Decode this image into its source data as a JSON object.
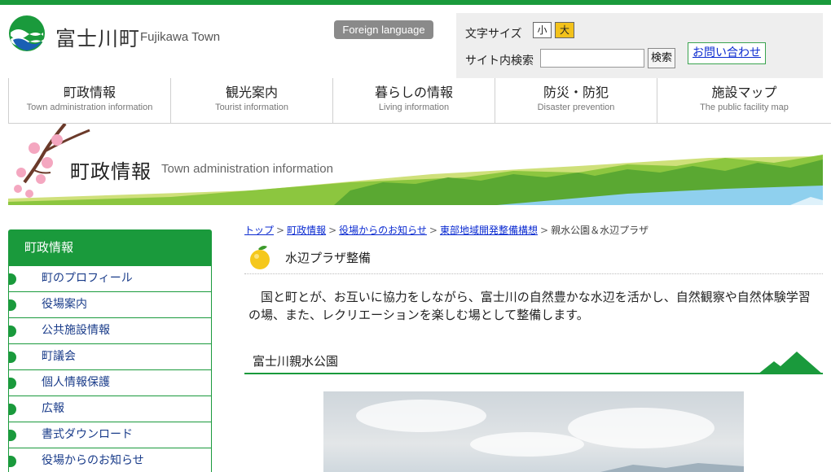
{
  "header": {
    "site_title": "富士川町",
    "site_title_en": "Fujikawa Town",
    "foreign_language": "Foreign language",
    "font_size_label": "文字サイズ",
    "font_size_small": "小",
    "font_size_large": "大",
    "search_label": "サイト内検索",
    "search_value": "",
    "search_button": "検索",
    "contact": "お問い合わせ"
  },
  "nav": [
    {
      "jp": "町政情報",
      "en": "Town administration information"
    },
    {
      "jp": "観光案内",
      "en": "Tourist information"
    },
    {
      "jp": "暮らしの情報",
      "en": "Living information"
    },
    {
      "jp": "防災・防犯",
      "en": "Disaster prevention"
    },
    {
      "jp": "施設マップ",
      "en": "The public facility map"
    }
  ],
  "banner": {
    "title": "町政情報",
    "subtitle": "Town administration information"
  },
  "sidebar": {
    "heading": "町政情報",
    "items": [
      "町のプロフィール",
      "役場案内",
      "公共施設情報",
      "町議会",
      "個人情報保護",
      "広報",
      "書式ダウンロード",
      "役場からのお知らせ"
    ]
  },
  "breadcrumb": {
    "items": [
      "トップ",
      "町政情報",
      "役場からのお知らせ",
      "東部地域開発整備構想"
    ],
    "current": "親水公園＆水辺プラザ",
    "separator": ">"
  },
  "main": {
    "heading": "水辺プラザ整備",
    "lead": "国と町とが、お互いに協力をしながら、富士川の自然豊かな水辺を活かし、自然観察や自然体験学習の場、また、レクリエーションを楽しむ場として整備します。",
    "subheading": "富士川親水公園"
  },
  "colors": {
    "brand_green": "#1a9a3c",
    "accent_yellow": "#f3c21b",
    "link_blue": "#0b2bd1"
  }
}
